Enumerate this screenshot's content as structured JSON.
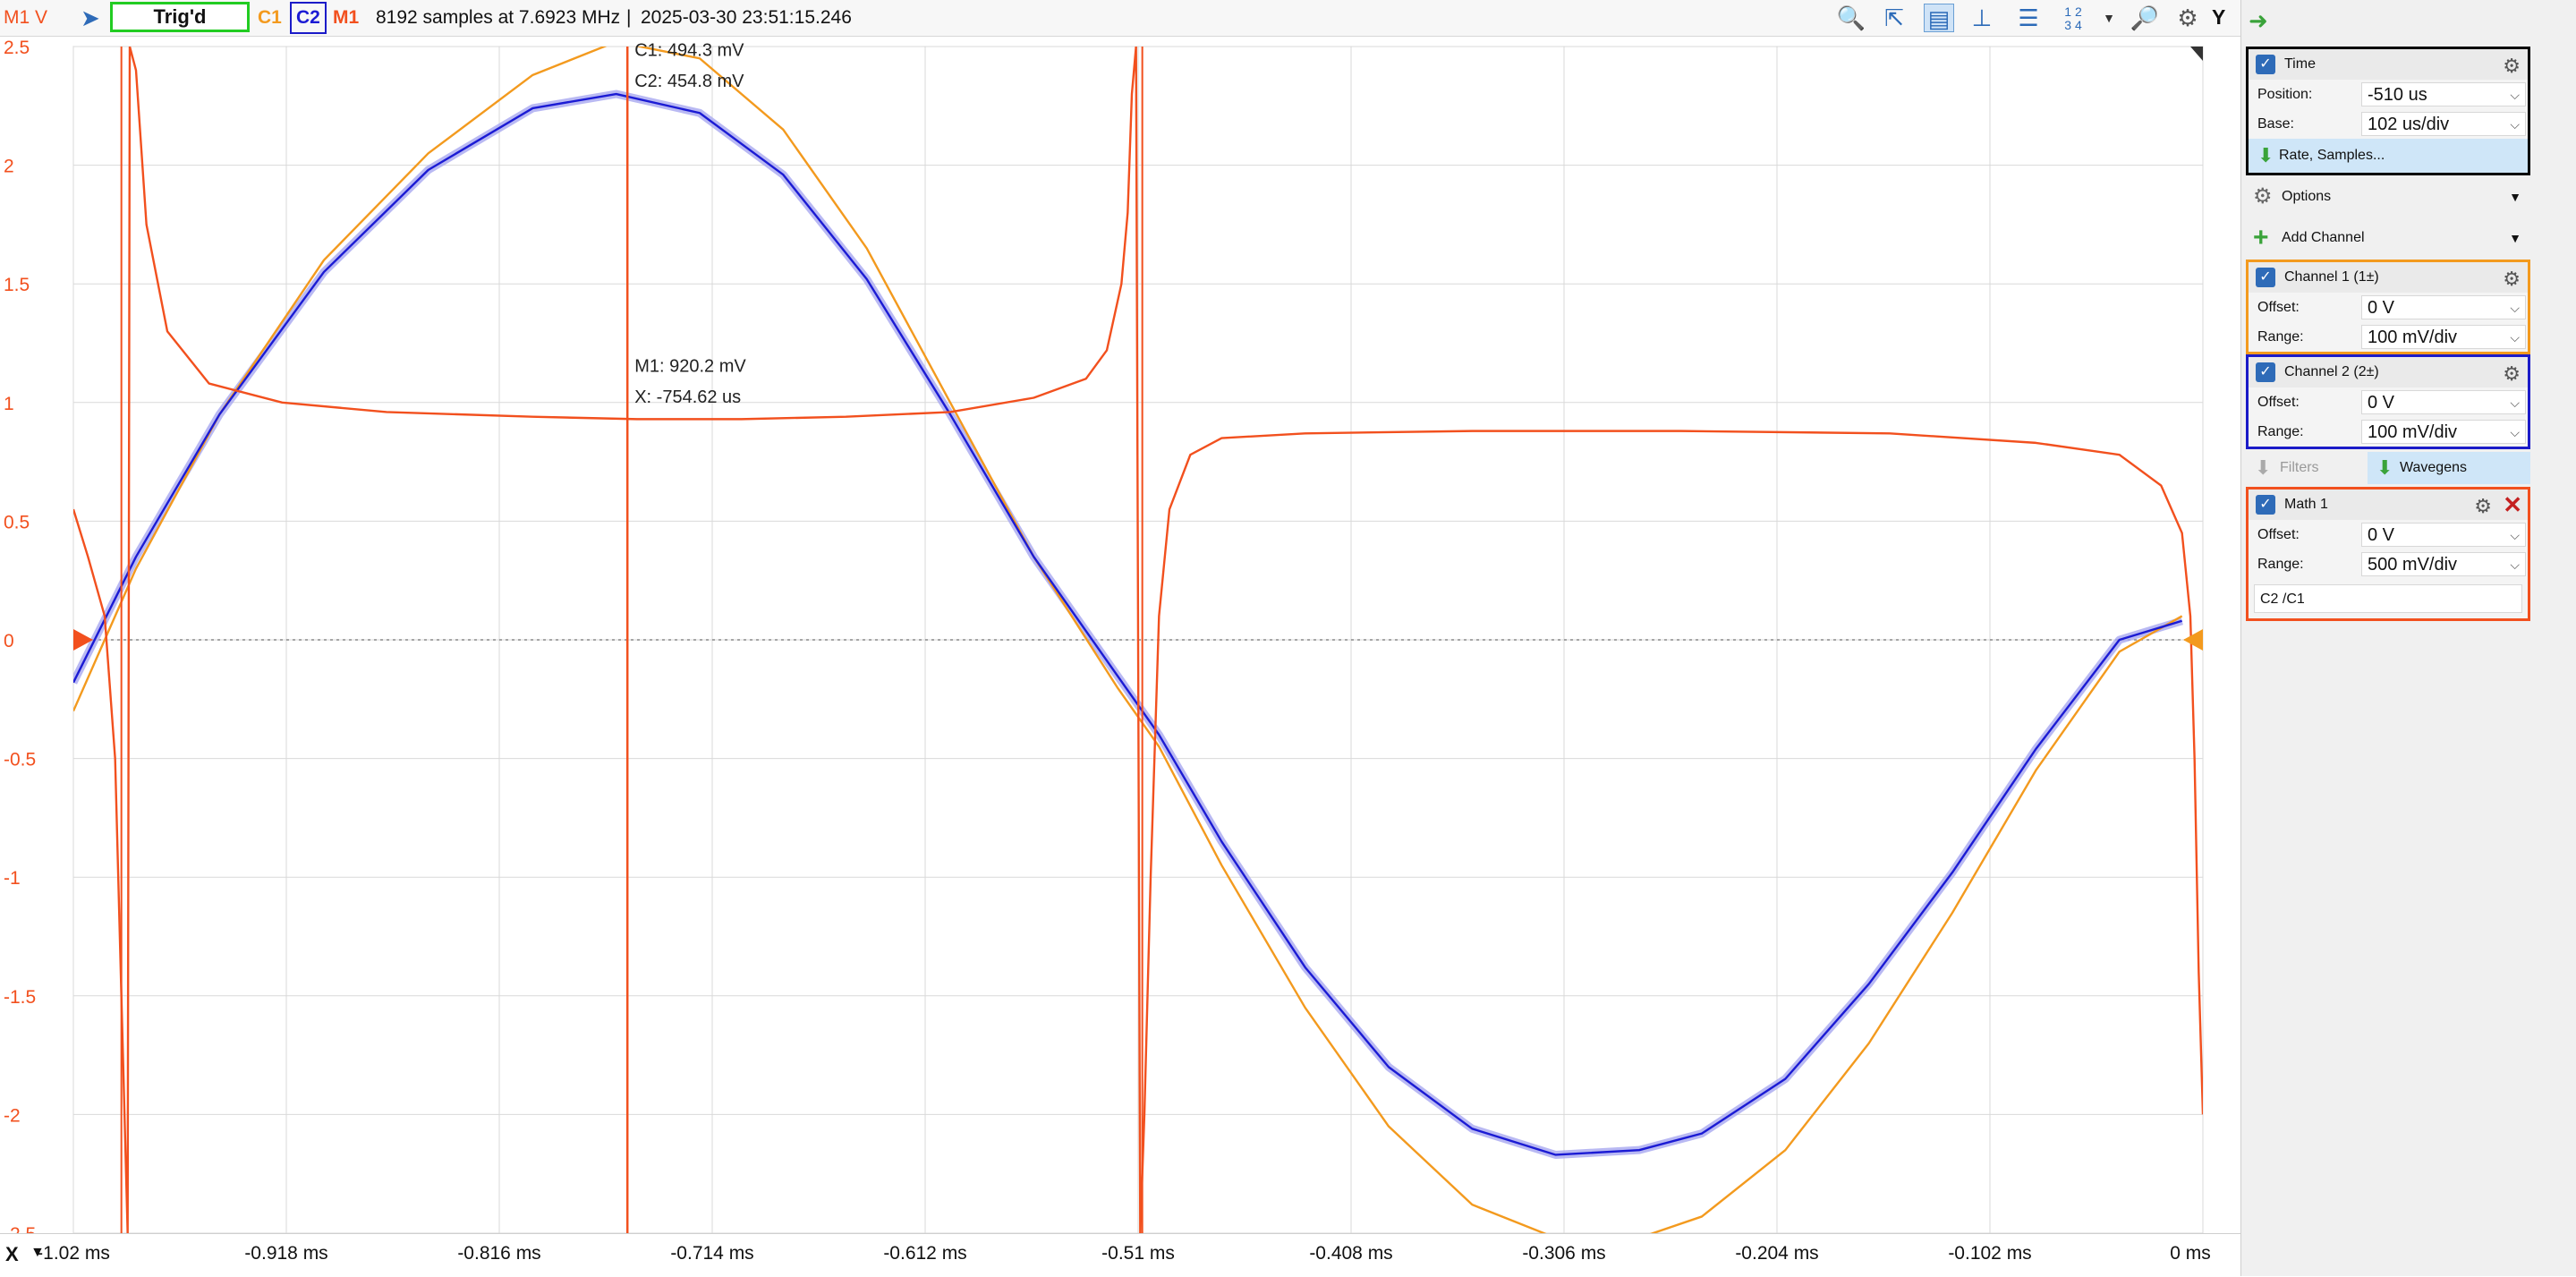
{
  "toolbar": {
    "y_axis_unit": "M1 V",
    "run_icon": "play-chevron-icon",
    "status": "Trig'd",
    "channel_tags": [
      "C1",
      "C2",
      "M1"
    ],
    "acquisition": "8192 samples at 7.6923 MHz",
    "separator": "|",
    "timestamp": "2025-03-30 23:51:15.246",
    "tools": [
      "zoom-icon",
      "cursor-icon",
      "horizontal-cursor-icon",
      "vertical-cursor-icon",
      "measure-icon",
      "numbered-cursors-icon",
      "zoom-fit-icon",
      "settings-icon"
    ],
    "y_button": "Y"
  },
  "colors": {
    "c1": "#f39a1e",
    "c2": "#1b1bd4",
    "c2_noise": "#a8a8f0",
    "m1": "#f2501e",
    "grid": "#d9d9d9",
    "status_border": "#22cc22",
    "panel_time": "#000000",
    "panel_ch1": "#f39a1e",
    "panel_ch2": "#1b1bc8",
    "panel_math": "#f2501e",
    "accent": "#2e6bb8"
  },
  "chart_data": {
    "type": "line",
    "x_unit": "ms",
    "y_unit": "V",
    "xlim": [
      -1.02,
      0.0
    ],
    "ylim": [
      -2.5,
      2.5
    ],
    "x_ticks": [
      "-1.02 ms",
      "-0.918 ms",
      "-0.816 ms",
      "-0.714 ms",
      "-0.612 ms",
      "-0.51 ms",
      "-0.408 ms",
      "-0.306 ms",
      "-0.204 ms",
      "-0.102 ms",
      "0 ms"
    ],
    "y_ticks": [
      "2.5",
      "2",
      "1.5",
      "1",
      "0.5",
      "0",
      "-0.5",
      "-1",
      "-1.5",
      "-2",
      "-2.5"
    ],
    "grid": true,
    "series": [
      {
        "name": "C1",
        "x": [
          -1.02,
          -0.99,
          -0.95,
          -0.9,
          -0.85,
          -0.8,
          -0.76,
          -0.72,
          -0.68,
          -0.64,
          -0.6,
          -0.56,
          -0.52,
          -0.5,
          -0.47,
          -0.43,
          -0.39,
          -0.35,
          -0.31,
          -0.27,
          -0.24,
          -0.2,
          -0.16,
          -0.12,
          -0.08,
          -0.04,
          -0.01
        ],
        "y": [
          -0.3,
          0.3,
          0.95,
          1.6,
          2.05,
          2.38,
          2.52,
          2.45,
          2.15,
          1.65,
          1.0,
          0.35,
          -0.2,
          -0.45,
          -0.95,
          -1.55,
          -2.05,
          -2.38,
          -2.52,
          -2.52,
          -2.43,
          -2.15,
          -1.7,
          -1.15,
          -0.55,
          -0.05,
          0.1
        ]
      },
      {
        "name": "C2",
        "x": [
          -1.02,
          -0.99,
          -0.95,
          -0.9,
          -0.85,
          -0.8,
          -0.76,
          -0.72,
          -0.68,
          -0.64,
          -0.6,
          -0.56,
          -0.52,
          -0.5,
          -0.47,
          -0.43,
          -0.39,
          -0.35,
          -0.31,
          -0.27,
          -0.24,
          -0.2,
          -0.16,
          -0.12,
          -0.08,
          -0.04,
          -0.01
        ],
        "y": [
          -0.18,
          0.35,
          0.95,
          1.55,
          1.98,
          2.24,
          2.3,
          2.22,
          1.96,
          1.52,
          0.95,
          0.35,
          -0.15,
          -0.4,
          -0.85,
          -1.38,
          -1.8,
          -2.06,
          -2.17,
          -2.15,
          -2.08,
          -1.85,
          -1.45,
          -0.98,
          -0.46,
          0.0,
          0.08
        ]
      },
      {
        "name": "M1",
        "x": [
          -1.02,
          -1.013,
          -1.005,
          -1.0,
          -0.997,
          -0.994,
          -0.993,
          -0.99,
          -0.985,
          -0.975,
          -0.955,
          -0.92,
          -0.87,
          -0.8,
          -0.75,
          -0.7,
          -0.65,
          -0.6,
          -0.56,
          -0.535,
          -0.525,
          -0.518,
          -0.515,
          -0.513,
          -0.511,
          -0.509,
          -0.507,
          -0.504,
          -0.5,
          -0.495,
          -0.485,
          -0.47,
          -0.43,
          -0.35,
          -0.25,
          -0.15,
          -0.08,
          -0.04,
          -0.02,
          -0.01,
          -0.006,
          -0.004,
          -0.002,
          0.0
        ],
        "y": [
          0.55,
          0.35,
          0.1,
          -0.5,
          -1.5,
          -2.5,
          2.5,
          2.4,
          1.75,
          1.3,
          1.08,
          1.0,
          0.96,
          0.94,
          0.93,
          0.93,
          0.94,
          0.96,
          1.02,
          1.1,
          1.22,
          1.5,
          1.8,
          2.3,
          2.5,
          -2.5,
          -2.0,
          -1.0,
          0.1,
          0.55,
          0.78,
          0.85,
          0.87,
          0.88,
          0.88,
          0.87,
          0.83,
          0.78,
          0.65,
          0.45,
          0.1,
          -0.5,
          -1.4,
          -2.0
        ]
      }
    ],
    "markers": [
      {
        "name": "M1 cursor",
        "x": -0.75462
      },
      {
        "name": "M1 spike",
        "x": -0.997
      },
      {
        "name": "M1 spike",
        "x": -0.508
      }
    ],
    "annotations": [
      {
        "text": "C1: 494.3 mV"
      },
      {
        "text": "C2: 454.8 mV"
      },
      {
        "text": "M1: 920.2 mV"
      },
      {
        "text": "X: -754.62 us"
      }
    ]
  },
  "x_axis": {
    "button": "X",
    "dropdown": "▼"
  },
  "right_panel": {
    "nav_icon": "green-arrow-right-icon",
    "time": {
      "title": "Time",
      "position_label": "Position:",
      "position_value": "-510 us",
      "base_label": "Base:",
      "base_value": "102 us/div",
      "rate_button": "Rate, Samples..."
    },
    "options_label": "Options",
    "add_channel_label": "Add Channel",
    "channel1": {
      "title": "Channel 1 (1±)",
      "offset_label": "Offset:",
      "offset_value": "0 V",
      "range_label": "Range:",
      "range_value": "100 mV/div"
    },
    "channel2": {
      "title": "Channel 2 (2±)",
      "offset_label": "Offset:",
      "offset_value": "0 V",
      "range_label": "Range:",
      "range_value": "100 mV/div"
    },
    "filters_label": "Filters",
    "wavegens_label": "Wavegens",
    "math1": {
      "title": "Math 1",
      "offset_label": "Offset:",
      "offset_value": "0 V",
      "range_label": "Range:",
      "range_value": "500 mV/div",
      "expression": "C2 /C1"
    }
  }
}
